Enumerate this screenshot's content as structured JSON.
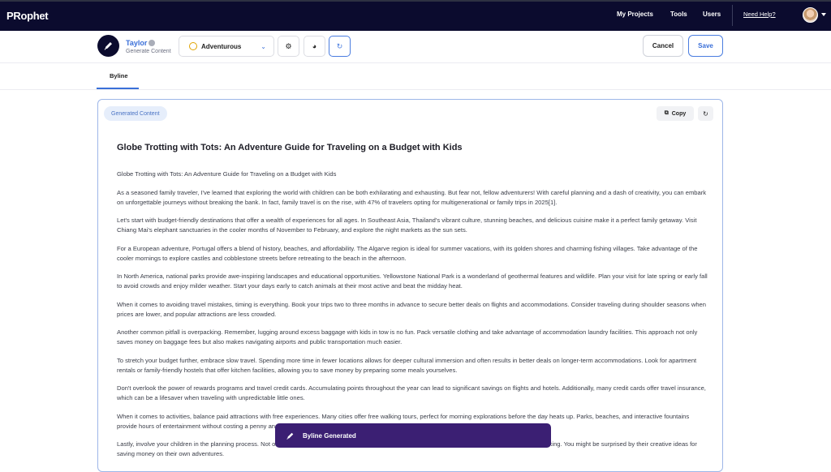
{
  "app": {
    "logo": "PRophet"
  },
  "nav": {
    "my_projects": "My Projects",
    "tools": "Tools",
    "users": "Users",
    "help": "Need Help?"
  },
  "toolbar": {
    "persona_name": "Taylor",
    "persona_sub": "Generate Content",
    "tone": "Adventurous",
    "cancel": "Cancel",
    "save": "Save"
  },
  "tabs": [
    {
      "label": "Byline"
    }
  ],
  "panel": {
    "chip": "Generated Content",
    "copy": "Copy",
    "title": "Globe Trotting with Tots: An Adventure Guide for Traveling on a Budget with Kids",
    "paragraphs": [
      "Globe Trotting with Tots: An Adventure Guide for Traveling on a Budget with Kids",
      "As a seasoned family traveler, I've learned that exploring the world with children can be both exhilarating and exhausting. But fear not, fellow adventurers! With careful planning and a dash of creativity, you can embark on unforgettable journeys without breaking the bank. In fact, family travel is on the rise, with 47% of travelers opting for multigenerational or family trips in 2025[1].",
      "Let's start with budget-friendly destinations that offer a wealth of experiences for all ages. In Southeast Asia, Thailand's vibrant culture, stunning beaches, and delicious cuisine make it a perfect family getaway. Visit Chiang Mai's elephant sanctuaries in the cooler months of November to February, and explore the night markets as the sun sets.",
      "For a European adventure, Portugal offers a blend of history, beaches, and affordability. The Algarve region is ideal for summer vacations, with its golden shores and charming fishing villages. Take advantage of the cooler mornings to explore castles and cobblestone streets before retreating to the beach in the afternoon.",
      "In North America, national parks provide awe-inspiring landscapes and educational opportunities. Yellowstone National Park is a wonderland of geothermal features and wildlife. Plan your visit for late spring or early fall to avoid crowds and enjoy milder weather. Start your days early to catch animals at their most active and beat the midday heat.",
      "When it comes to avoiding travel mistakes, timing is everything. Book your trips two to three months in advance to secure better deals on flights and accommodations. Consider traveling during shoulder seasons when prices are lower, and popular attractions are less crowded.",
      "Another common pitfall is overpacking. Remember, lugging around excess baggage with kids in tow is no fun. Pack versatile clothing and take advantage of accommodation laundry facilities. This approach not only saves money on baggage fees but also makes navigating airports and public transportation much easier.",
      "To stretch your budget further, embrace slow travel. Spending more time in fewer locations allows for deeper cultural immersion and often results in better deals on longer-term accommodations. Look for apartment rentals or family-friendly hostels that offer kitchen facilities, allowing you to save money by preparing some meals yourselves.",
      "Don't overlook the power of rewards programs and travel credit cards. Accumulating points throughout the year can lead to significant savings on flights and hotels. Additionally, many credit cards offer travel insurance, which can be a lifesaver when traveling with unpredictable little ones.",
      "When it comes to activities, balance paid attractions with free experiences. Many cities offer free walking tours, perfect for morning explorations before the day heats up. Parks, beaches, and interactive fountains provide hours of entertainment without costing a penny and offer a welcome escape from the heat.",
      "Lastly, involve your children in the planning process. Not only does this build excitement, but it also teaches valuable lessons about budgeting and decision-making. You might be surprised by their creative ideas for saving money on their own adventures."
    ]
  },
  "toast": {
    "message": "Byline Generated"
  }
}
